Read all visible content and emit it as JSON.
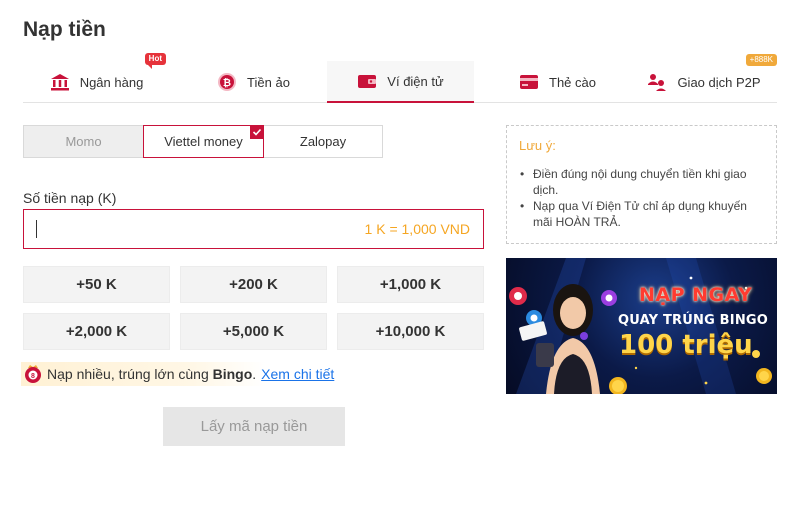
{
  "page": {
    "title": "Nạp tiền"
  },
  "tabs": [
    {
      "label": "Ngân hàng",
      "badge": "Hot",
      "icon": "bank-icon"
    },
    {
      "label": "Tiền ảo",
      "badge": "",
      "icon": "crypto-coin-icon"
    },
    {
      "label": "Ví điện tử",
      "badge": "",
      "icon": "wallet-icon",
      "active": true
    },
    {
      "label": "Thẻ cào",
      "badge": "",
      "icon": "card-icon"
    },
    {
      "label": "Giao dịch P2P",
      "badge": "+888K",
      "icon": "p2p-users-icon"
    }
  ],
  "wallets": [
    {
      "label": "Momo",
      "state": "disabled"
    },
    {
      "label": "Viettel money",
      "state": "selected"
    },
    {
      "label": "Zalopay",
      "state": "normal"
    }
  ],
  "amount": {
    "label": "Số tiền nạp (K)",
    "value": "",
    "rate": "1 K = 1,000 VND"
  },
  "quick_amounts": [
    "+50 K",
    "+200 K",
    "+1,000 K",
    "+2,000 K",
    "+5,000 K",
    "+10,000 K"
  ],
  "promo": {
    "text_prefix": "Nạp nhiều, trúng lớn cùng ",
    "text_bold": "Bingo",
    "text_suffix": ".",
    "link": "Xem chi tiết"
  },
  "submit_label": "Lấy mã nạp tiền",
  "note": {
    "title": "Lưu ý:",
    "items": [
      "Điền đúng nội dung chuyển tiền khi giao dịch.",
      "Nạp qua Ví Điện Tử chỉ áp dụng khuyến mãi HOÀN TRẢ."
    ]
  },
  "banner": {
    "line1": "NẠP NGAY",
    "line2": "QUAY TRÚNG BINGO",
    "line3": "100 triệu"
  },
  "colors": {
    "accent": "#c8123a",
    "note_title": "#f0a93b",
    "rate": "#f5a623",
    "link": "#1a73e8"
  }
}
